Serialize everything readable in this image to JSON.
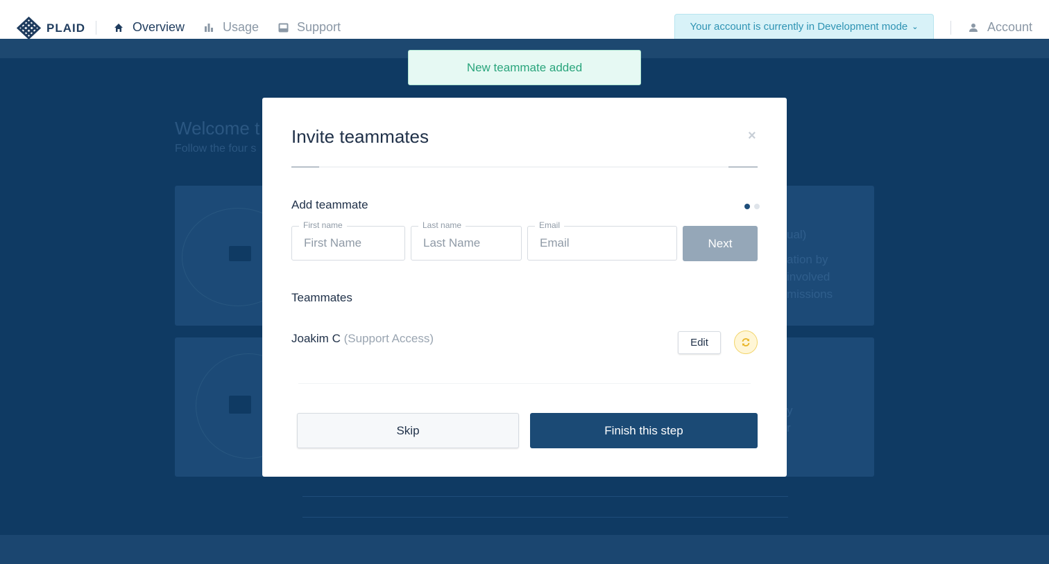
{
  "brand": {
    "name": "PLAID"
  },
  "nav": {
    "items": [
      {
        "label": "Overview",
        "icon": "home-icon"
      },
      {
        "label": "Usage",
        "icon": "bar-chart-icon"
      },
      {
        "label": "Support",
        "icon": "inbox-icon"
      }
    ],
    "active": "Overview",
    "dev_banner": "Your account is currently in Development mode",
    "account_label": "Account"
  },
  "toast": {
    "message": "New teammate added"
  },
  "modal": {
    "title": "Invite teammates",
    "add_section": "Add teammate",
    "steps": {
      "current": 1,
      "total": 2
    },
    "fields": {
      "first_name": {
        "label": "First name",
        "placeholder": "First Name",
        "value": ""
      },
      "last_name": {
        "label": "Last name",
        "placeholder": "Last Name",
        "value": ""
      },
      "email": {
        "label": "Email",
        "placeholder": "Email",
        "value": ""
      }
    },
    "next_label": "Next",
    "teammates_section": "Teammates",
    "teammates": [
      {
        "name": "Joakim C",
        "access": "(Support Access)"
      }
    ],
    "edit_label": "Edit",
    "skip_label": "Skip",
    "finish_label": "Finish this step"
  },
  "colors": {
    "primary": "#1b4a75",
    "overlay": "#0f3a63",
    "success_text": "#2aa57c",
    "dev_banner_text": "#2e93b3",
    "next_disabled": "#95a7b8"
  }
}
